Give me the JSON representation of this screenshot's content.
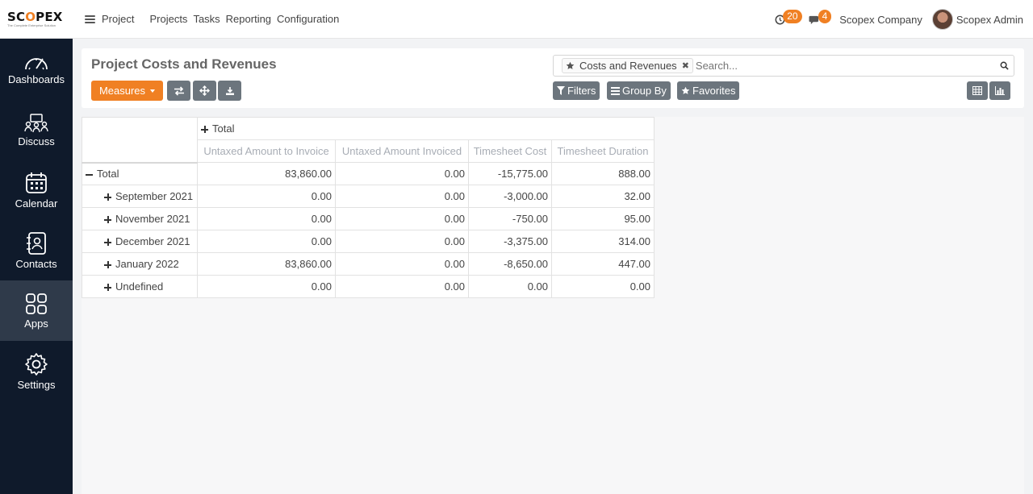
{
  "brand": {
    "name_a": "SC",
    "name_o": "O",
    "name_b": "PEX",
    "tagline": "The Complete Enterprise Solution"
  },
  "topbar": {
    "app_name": "Project",
    "nav": [
      "Projects",
      "Tasks",
      "Reporting",
      "Configuration"
    ],
    "activity_count": "20",
    "message_count": "4",
    "company": "Scopex Company",
    "user": "Scopex Admin"
  },
  "sidebar": {
    "items": [
      {
        "label": "Dashboards",
        "icon": "dashboard-gauge-icon"
      },
      {
        "label": "Discuss",
        "icon": "discuss-people-icon"
      },
      {
        "label": "Calendar",
        "icon": "calendar-icon"
      },
      {
        "label": "Contacts",
        "icon": "contacts-book-icon"
      },
      {
        "label": "Apps",
        "icon": "apps-grid-icon",
        "active": true
      },
      {
        "label": "Settings",
        "icon": "gear-icon"
      }
    ]
  },
  "control_panel": {
    "title": "Project Costs and Revenues",
    "measures_label": "Measures",
    "facet_label": "Costs and Revenues",
    "search_placeholder": "Search...",
    "filters_label": "Filters",
    "groupby_label": "Group By",
    "favorites_label": "Favorites"
  },
  "pivot": {
    "col_header": "Total",
    "measures": [
      "Untaxed Amount to Invoice",
      "Untaxed Amount Invoiced",
      "Timesheet Cost",
      "Timesheet Duration"
    ],
    "total_row": {
      "label": "Total",
      "values": [
        "83,860.00",
        "0.00",
        "-15,775.00",
        "888.00"
      ]
    },
    "rows": [
      {
        "label": "September 2021",
        "values": [
          "0.00",
          "0.00",
          "-3,000.00",
          "32.00"
        ]
      },
      {
        "label": "November 2021",
        "values": [
          "0.00",
          "0.00",
          "-750.00",
          "95.00"
        ]
      },
      {
        "label": "December 2021",
        "values": [
          "0.00",
          "0.00",
          "-3,375.00",
          "314.00"
        ]
      },
      {
        "label": "January 2022",
        "values": [
          "83,860.00",
          "0.00",
          "-8,650.00",
          "447.00"
        ]
      },
      {
        "label": "Undefined",
        "values": [
          "0.00",
          "0.00",
          "0.00",
          "0.00"
        ]
      }
    ]
  },
  "colors": {
    "accent": "#f08023",
    "sidebar": "#0f1a2b",
    "button_gray": "#6c757d"
  }
}
